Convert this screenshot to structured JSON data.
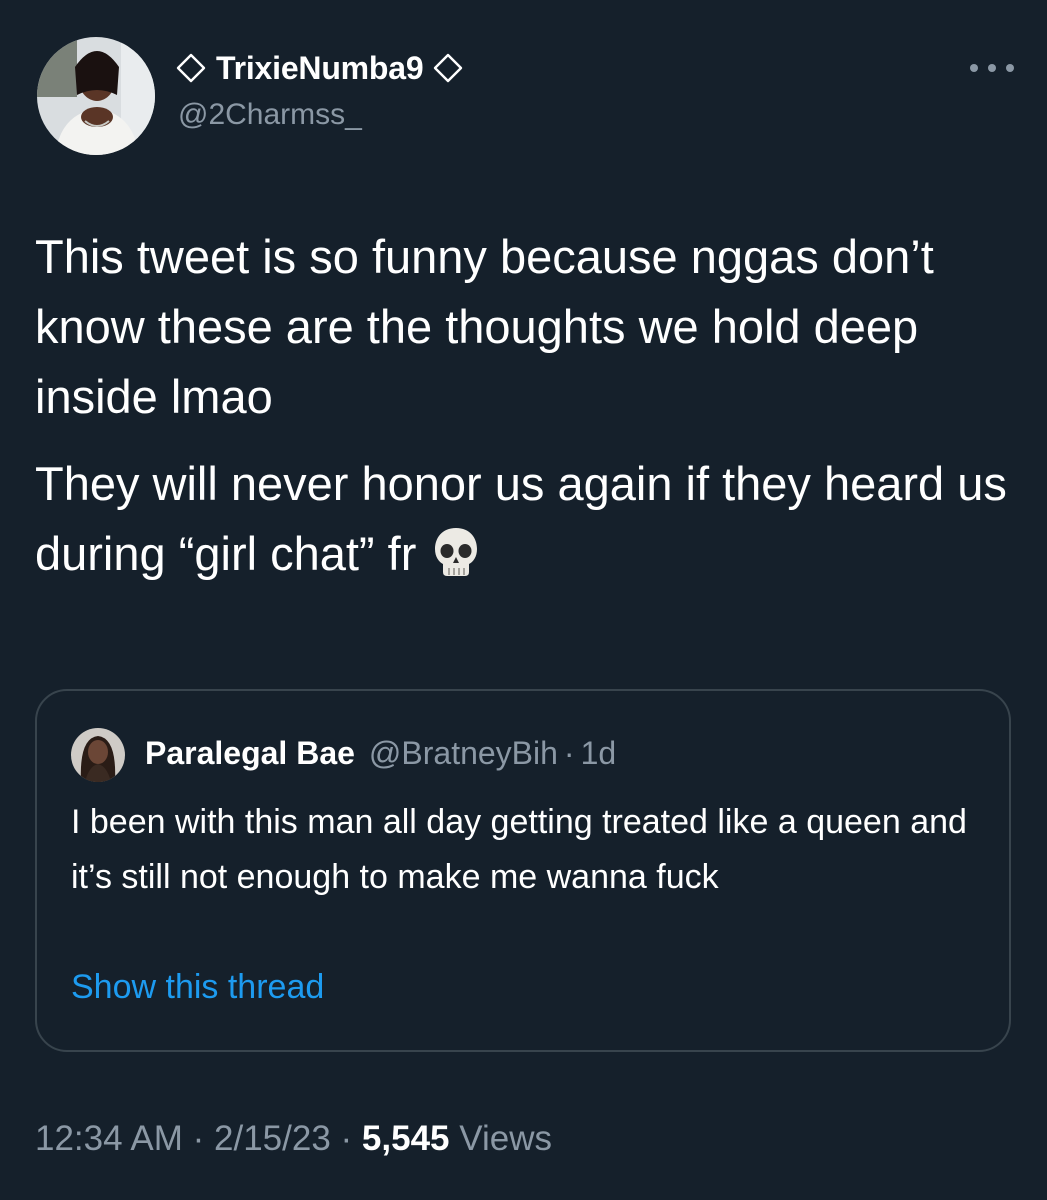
{
  "author": {
    "display_name": "TrixieNumba9",
    "handle": "@2Charmss_",
    "badge_icon": "diamond-outline-icon"
  },
  "tweet": {
    "paragraph_1": "This tweet is so funny because nggas don’t know these are the thoughts we hold deep inside lmao",
    "paragraph_2": "They will never honor us again if they heard us during “girl chat” fr",
    "emoji": "skull-emoji"
  },
  "quoted_tweet": {
    "display_name": "Paralegal Bae",
    "handle": "@BratneyBih",
    "separator": "·",
    "time": "1d",
    "text": "I been with this man all day getting treated like a queen and it’s still not enough to make me wanna fuck",
    "link": "Show this thread"
  },
  "meta": {
    "time": "12:34 AM",
    "sep1": "·",
    "date": "2/15/23",
    "sep2": "·",
    "views_count": "5,545",
    "views_label": "Views"
  },
  "colors": {
    "background": "#15202b",
    "text_primary": "#ffffff",
    "text_secondary": "#8b98a5",
    "link": "#1d9bf0",
    "border": "#38444d"
  }
}
